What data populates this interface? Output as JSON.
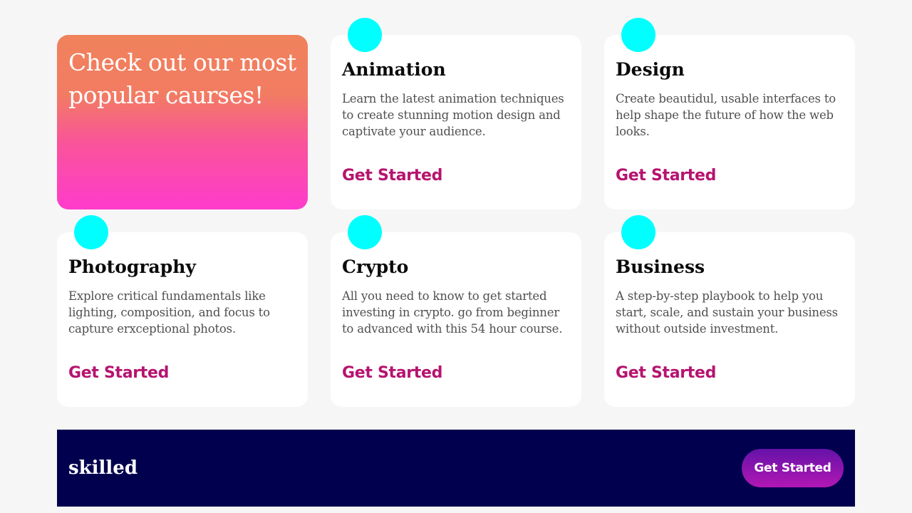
{
  "hero": {
    "title": "Check out our most popular caurses!"
  },
  "courses": [
    {
      "title": "Animation",
      "description": "Learn the latest animation techniques to create stunning motion design and captivate your audience.",
      "cta": "Get Started"
    },
    {
      "title": "Design",
      "description": "Create beautidul, usable interfaces to help shape the future of how the web looks.",
      "cta": "Get Started"
    },
    {
      "title": "Photography",
      "description": "Explore critical fundamentals like lighting, composition, and focus to capture erxceptional photos.",
      "cta": "Get Started"
    },
    {
      "title": "Crypto",
      "description": "All you need to know to get started investing in crypto. go from beginner to advanced with this 54 hour course.",
      "cta": "Get Started"
    },
    {
      "title": "Business",
      "description": "A step-by-step playbook to help you start, scale, and sustain your business without outside investment.",
      "cta": "Get Started"
    }
  ],
  "footer": {
    "logo": "skilled",
    "button_label": "Get Started"
  },
  "colors": {
    "background": "#f6f6f6",
    "card": "#ffffff",
    "accent_dot": "#00ffff",
    "cta_text": "#b6136f",
    "footer_bg": "#00004e",
    "hero_gradient_top": "#f0825c",
    "hero_gradient_bottom": "#ff3bcc",
    "button_gradient_top": "#6512a8",
    "button_gradient_bottom": "#b217b4"
  },
  "icons": {
    "course_badge": "cyan-circle-icon"
  }
}
